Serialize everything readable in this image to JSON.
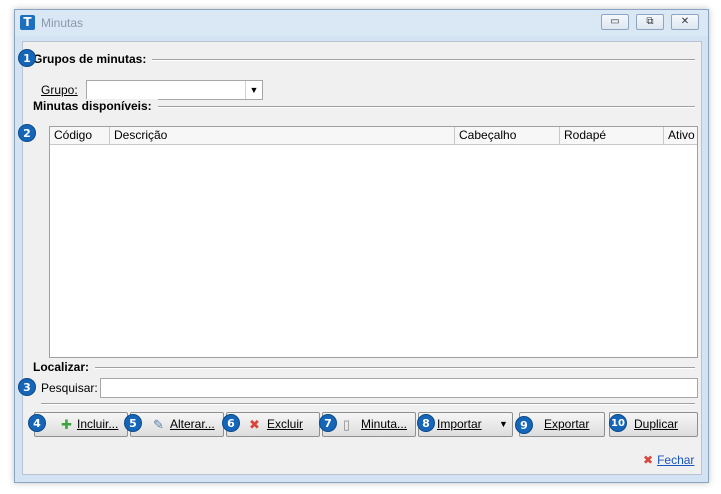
{
  "window": {
    "title": "Minutas",
    "app_icon_letter": "T",
    "controls": {
      "minimize": "▭",
      "restore": "⧉",
      "close": "✕"
    }
  },
  "groups_section": {
    "badge": "1",
    "title": "Grupos de minutas:",
    "grupo_label": "Grupo:",
    "grupo_value": ""
  },
  "available_section": {
    "badge": "2",
    "title": "Minutas disponíveis:",
    "columns": [
      "Código",
      "Descrição",
      "Cabeçalho",
      "Rodapé",
      "Ativo"
    ],
    "rows": []
  },
  "search_section": {
    "badge": "3",
    "title": "Localizar:",
    "pesquisar_label": "Pesquisar:",
    "pesquisar_value": ""
  },
  "toolbar": [
    {
      "badge": "4",
      "label": "Incluir...",
      "icon": "plus-icon",
      "icon_char": "✚",
      "icon_color": "#3aa53a"
    },
    {
      "badge": "5",
      "label": "Alterar...",
      "icon": "pencil-icon",
      "icon_char": "✎",
      "icon_color": "#5a7fb0"
    },
    {
      "badge": "6",
      "label": "Excluir",
      "icon": "delete-icon",
      "icon_char": "✖",
      "icon_color": "#d9453a"
    },
    {
      "badge": "7",
      "label": "Minuta...",
      "icon": "document-icon",
      "icon_char": "▯",
      "icon_color": "#8a8a8a"
    },
    {
      "badge": "8",
      "label": "Importar",
      "icon": "dropdown-arrow-icon",
      "icon_char": "▼",
      "icon_color": "#000000"
    },
    {
      "badge": "9",
      "label": "Exportar",
      "icon": "",
      "icon_char": "",
      "icon_color": "#000000"
    },
    {
      "badge": "10",
      "label": "Duplicar",
      "icon": "",
      "icon_char": "",
      "icon_color": "#000000"
    }
  ],
  "footer": {
    "close_label": "Fechar",
    "close_icon_char": "✖",
    "close_icon_color": "#d9453a"
  },
  "colors": {
    "badge": "#1565b8",
    "link": "#1a55c0"
  }
}
